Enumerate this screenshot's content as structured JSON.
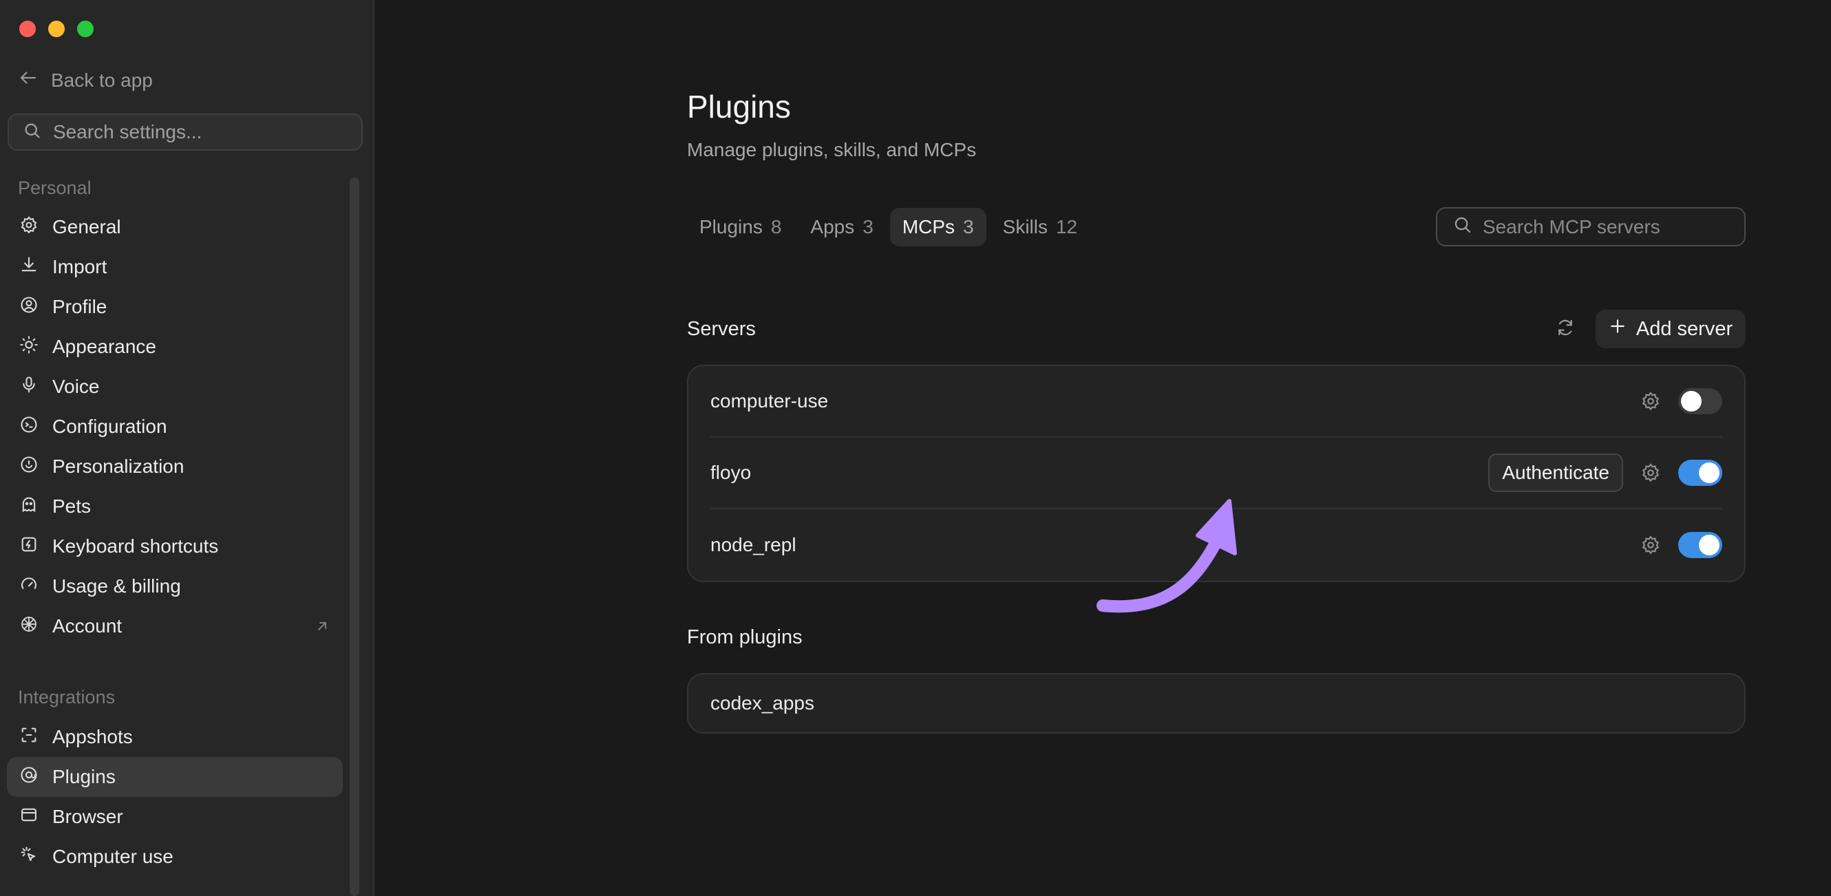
{
  "window": {
    "controls": [
      "close",
      "minimize",
      "maximize"
    ]
  },
  "sidebar": {
    "back_label": "Back to app",
    "search_placeholder": "Search settings...",
    "sections": [
      {
        "label": "Personal",
        "items": [
          {
            "label": "General",
            "icon": "gear-icon"
          },
          {
            "label": "Import",
            "icon": "download-icon"
          },
          {
            "label": "Profile",
            "icon": "user-circle-icon"
          },
          {
            "label": "Appearance",
            "icon": "sun-icon"
          },
          {
            "label": "Voice",
            "icon": "microphone-icon"
          },
          {
            "label": "Configuration",
            "icon": "config-icon"
          },
          {
            "label": "Personalization",
            "icon": "personalization-icon"
          },
          {
            "label": "Pets",
            "icon": "pet-icon"
          },
          {
            "label": "Keyboard shortcuts",
            "icon": "keyboard-shortcut-icon"
          },
          {
            "label": "Usage & billing",
            "icon": "gauge-icon"
          },
          {
            "label": "Account",
            "icon": "account-icon",
            "external": true
          }
        ]
      },
      {
        "label": "Integrations",
        "items": [
          {
            "label": "Appshots",
            "icon": "appshots-icon"
          },
          {
            "label": "Plugins",
            "icon": "plugins-icon",
            "active": true
          },
          {
            "label": "Browser",
            "icon": "browser-icon"
          },
          {
            "label": "Computer use",
            "icon": "pointer-icon"
          }
        ]
      }
    ]
  },
  "main": {
    "title": "Plugins",
    "subtitle": "Manage plugins, skills, and MCPs",
    "tabs": [
      {
        "label": "Plugins",
        "count": "8"
      },
      {
        "label": "Apps",
        "count": "3"
      },
      {
        "label": "MCPs",
        "count": "3",
        "active": true
      },
      {
        "label": "Skills",
        "count": "12"
      }
    ],
    "search_placeholder": "Search MCP servers",
    "servers_label": "Servers",
    "add_server_label": "Add server",
    "servers": [
      {
        "name": "computer-use",
        "enabled": false,
        "needs_auth": false
      },
      {
        "name": "floyo",
        "enabled": true,
        "needs_auth": true
      },
      {
        "name": "node_repl",
        "enabled": true,
        "needs_auth": false
      }
    ],
    "authenticate_label": "Authenticate",
    "from_plugins_label": "From plugins",
    "plugin_servers": [
      {
        "name": "codex_apps"
      }
    ]
  },
  "colors": {
    "accent": "#3b8fe6",
    "annotation_arrow": "#b489ff",
    "background": "#1a1a1a",
    "sidebar_bg": "#272727"
  }
}
